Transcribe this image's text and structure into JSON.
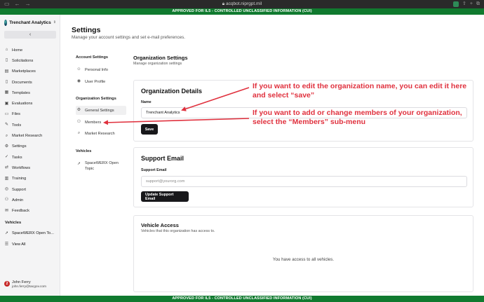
{
  "browser": {
    "url": "acqbot.niprgpt.mil"
  },
  "banner": {
    "top": "APPROVED FOR IL5 - CONTROLLED UNCLASSIFIED INFORMATION (CUI)",
    "bottom": "APPROVED FOR IL5 - CONTROLLED UNCLASSIFIED INFORMATION (CUI)",
    "color": "#107a2f"
  },
  "sidebar": {
    "org_name": "Trenchant Analytics",
    "collapse_icon": "chevron-left-icon",
    "items": [
      {
        "label": "Home",
        "icon": "home-icon"
      },
      {
        "label": "Solicitations",
        "icon": "file-icon"
      },
      {
        "label": "Marketplaces",
        "icon": "store-icon"
      },
      {
        "label": "Documents",
        "icon": "document-icon"
      },
      {
        "label": "Templates",
        "icon": "template-icon"
      },
      {
        "label": "Evaluations",
        "icon": "clipboard-icon"
      },
      {
        "label": "Files",
        "icon": "folder-icon"
      },
      {
        "label": "Tools",
        "icon": "wrench-icon"
      },
      {
        "label": "Market Research",
        "icon": "search-icon"
      },
      {
        "label": "Settings",
        "icon": "gear-icon"
      },
      {
        "label": "Tasks",
        "icon": "check-icon"
      },
      {
        "label": "Workflows",
        "icon": "workflow-icon"
      },
      {
        "label": "Training",
        "icon": "training-icon"
      },
      {
        "label": "Support",
        "icon": "support-icon"
      },
      {
        "label": "Admin",
        "icon": "admin-icon"
      },
      {
        "label": "Feedback",
        "icon": "feedback-icon"
      }
    ],
    "vehicles_heading": "Vehicles",
    "vehicle_item": "SpaceWERX Open To...",
    "view_all": "View All",
    "user_name": "John Ferry",
    "user_email": "john.ferry@tacgov.com",
    "user_badge": "2"
  },
  "page": {
    "title": "Settings",
    "subtitle": "Manage your account settings and set e-mail preferences."
  },
  "settings_nav": {
    "account_heading": "Account Settings",
    "personal_info": "Personal Info",
    "user_profile": "User Profile",
    "org_heading": "Organization Settings",
    "general_settings": "General Settings",
    "members": "Members",
    "market_research": "Market Research",
    "vehicles_heading": "Vehicles",
    "vehicle_item": "SpaceWERX Open Topic"
  },
  "org_settings": {
    "title": "Organization Settings",
    "subtitle": "Manage organization settings"
  },
  "org_details": {
    "title": "Organization Details",
    "name_label": "Name",
    "name_value": "Trenchant Analytics",
    "save_label": "Save"
  },
  "support_email": {
    "title": "Support Email",
    "label": "Support Email",
    "placeholder": "support@yourorg.com",
    "button": "Update Support Email"
  },
  "vehicle_access": {
    "title": "Vehicle Access",
    "subtitle": "Vehicles that this organization has access to.",
    "message": "You have access to all vehicles."
  },
  "annotations": {
    "edit_line1": "If you want to edit the organization name, you can edit it here",
    "edit_line2": "and select “save”",
    "members_line1": "If you want to add or change members of your organization,",
    "members_line2": "select the “Members” sub-menu",
    "color": "#e0313e"
  }
}
